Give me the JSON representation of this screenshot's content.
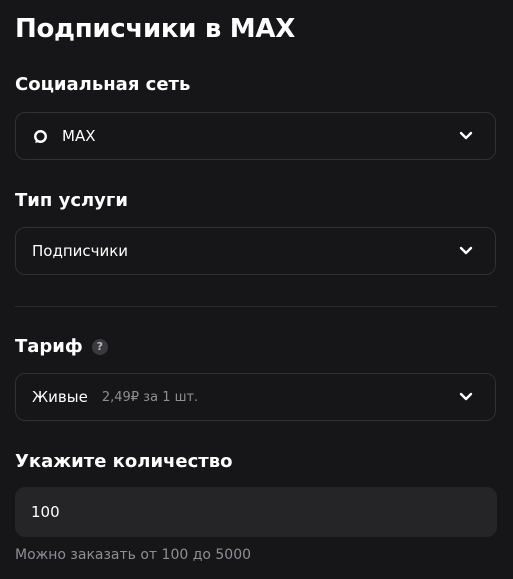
{
  "page": {
    "title": "Подписчики в MAX"
  },
  "social_network": {
    "label": "Социальная сеть",
    "selected": "MAX",
    "icon": "max-logo-icon"
  },
  "service_type": {
    "label": "Тип услуги",
    "selected": "Подписчики"
  },
  "tariff": {
    "label": "Тариф",
    "help_symbol": "?",
    "selected": "Живые",
    "price": "2,49₽ за 1 шт."
  },
  "quantity": {
    "label": "Укажите количество",
    "value": "100",
    "hint": "Можно заказать от 100 до 5000"
  },
  "colors": {
    "background": "#161618",
    "field_border": "#303035",
    "input_fill": "#252528",
    "muted_text": "#8e8e93"
  }
}
